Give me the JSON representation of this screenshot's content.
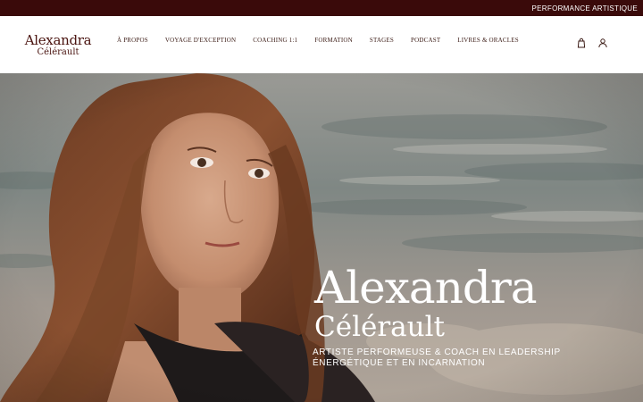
{
  "topbar": {
    "link": "PERFORMANCE ARTISTIQUE"
  },
  "logo": {
    "first": "Alexandra",
    "last": "Célérault"
  },
  "nav": {
    "items": [
      {
        "label": "À PROPOS"
      },
      {
        "label": "VOYAGE D'EXCEPTION"
      },
      {
        "label": "COACHING 1:1"
      },
      {
        "label": "FORMATION"
      },
      {
        "label": "STAGES"
      },
      {
        "label": "PODCAST"
      },
      {
        "label": "LIVRES & ORACLES"
      }
    ]
  },
  "header_icons": {
    "cart": "shopping-bag-icon",
    "account": "user-icon"
  },
  "hero": {
    "title": "Alexandra",
    "subtitle": "Célérault",
    "tagline_line1": "ARTISTE PERFORMEUSE & COACH EN LEADERSHIP",
    "tagline_line2": "ÉNERGÉTIQUE ET EN INCARNATION"
  },
  "colors": {
    "topbar_bg": "#3a0a0a",
    "brand": "#4a1410",
    "hero_text": "#ffffff"
  }
}
